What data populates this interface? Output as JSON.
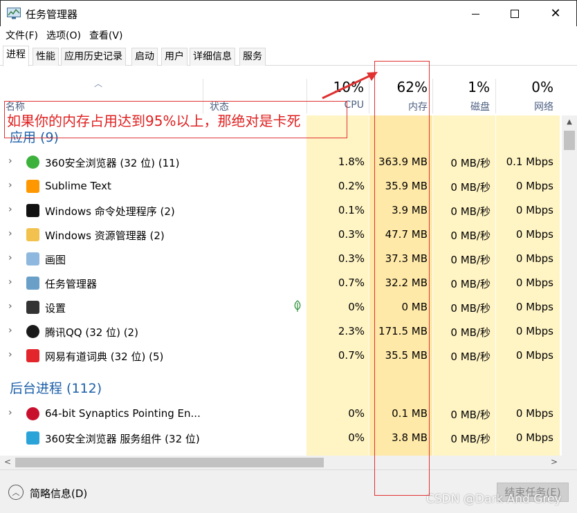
{
  "window": {
    "title": "任务管理器",
    "close_glyph": "✕"
  },
  "menu": [
    "文件(F)",
    "选项(O)",
    "查看(V)"
  ],
  "tabs": [
    "进程",
    "性能",
    "应用历史记录",
    "启动",
    "用户",
    "详细信息",
    "服务"
  ],
  "columns": {
    "name": "名称",
    "status": "状态",
    "cpu": {
      "pct": "10%",
      "label": "CPU"
    },
    "memory": {
      "pct": "62%",
      "label": "内存"
    },
    "disk": {
      "pct": "1%",
      "label": "磁盘"
    },
    "network": {
      "pct": "0%",
      "label": "网络"
    }
  },
  "apps_group": "应用 (9)",
  "background_group": "后台进程 (112)",
  "apps": [
    {
      "name": "360安全浏览器 (32 位) (11)",
      "cpu": "1.8%",
      "mem": "363.9 MB",
      "disk": "0 MB/秒",
      "net": "0.1 Mbps",
      "icon": "360-browser-icon",
      "color": "#3cb13c"
    },
    {
      "name": "Sublime Text",
      "cpu": "0.2%",
      "mem": "35.9 MB",
      "disk": "0 MB/秒",
      "net": "0 Mbps",
      "icon": "sublime-text-icon",
      "color": "#ff9800"
    },
    {
      "name": "Windows 命令处理程序 (2)",
      "cpu": "0.1%",
      "mem": "3.9 MB",
      "disk": "0 MB/秒",
      "net": "0 Mbps",
      "icon": "cmd-icon",
      "color": "#111111"
    },
    {
      "name": "Windows 资源管理器 (2)",
      "cpu": "0.3%",
      "mem": "47.7 MB",
      "disk": "0 MB/秒",
      "net": "0 Mbps",
      "icon": "explorer-icon",
      "color": "#f2c14e"
    },
    {
      "name": "画图",
      "cpu": "0.3%",
      "mem": "37.3 MB",
      "disk": "0 MB/秒",
      "net": "0 Mbps",
      "icon": "paint-icon",
      "color": "#8fb8de"
    },
    {
      "name": "任务管理器",
      "cpu": "0.7%",
      "mem": "32.2 MB",
      "disk": "0 MB/秒",
      "net": "0 Mbps",
      "icon": "task-manager-icon",
      "color": "#6aa0c8"
    },
    {
      "name": "设置",
      "cpu": "0%",
      "mem": "0 MB",
      "disk": "0 MB/秒",
      "net": "0 Mbps",
      "icon": "settings-gear-icon",
      "color": "#333333"
    },
    {
      "name": "腾讯QQ (32 位) (2)",
      "cpu": "2.3%",
      "mem": "171.5 MB",
      "disk": "0 MB/秒",
      "net": "0 Mbps",
      "icon": "qq-icon",
      "color": "#1a1a1a"
    },
    {
      "name": "网易有道词典 (32 位) (5)",
      "cpu": "0.7%",
      "mem": "35.5 MB",
      "disk": "0 MB/秒",
      "net": "0 Mbps",
      "icon": "youdao-icon",
      "color": "#e3262b"
    }
  ],
  "background": [
    {
      "name": "64-bit Synaptics Pointing En...",
      "cpu": "0%",
      "mem": "0.1 MB",
      "disk": "0 MB/秒",
      "net": "0 Mbps",
      "icon": "synaptics-icon",
      "color": "#c8102e"
    },
    {
      "name": "360安全浏览器 服务组件 (32 位)",
      "cpu": "0%",
      "mem": "3.8 MB",
      "disk": "0 MB/秒",
      "net": "0 Mbps",
      "icon": "360-service-icon",
      "color": "#2aa3d8"
    }
  ],
  "footer": {
    "brief": "简略信息(D)",
    "end_task": "结束任务(E)",
    "watermark": "CSDN @Dark And Grey"
  },
  "annotation": {
    "text": "如果你的内存占用达到95%以上，那绝对是卡死",
    "color": "#e03030"
  },
  "colors": {
    "cpu_col": "#fff4c4",
    "mem_col": "#ffe9a8",
    "cell_light": "#fff4c4",
    "group_text": "#1c5fa8"
  }
}
